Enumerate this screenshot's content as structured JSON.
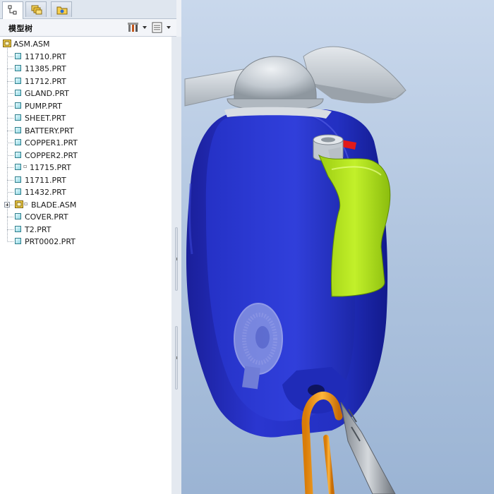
{
  "model_tree": {
    "title": "模型树",
    "root": "ASM.ASM",
    "items": [
      {
        "label": "11710.PRT",
        "kind": "part"
      },
      {
        "label": "11385.PRT",
        "kind": "part"
      },
      {
        "label": "11712.PRT",
        "kind": "part"
      },
      {
        "label": "GLAND.PRT",
        "kind": "part"
      },
      {
        "label": "PUMP.PRT",
        "kind": "part"
      },
      {
        "label": "SHEET.PRT",
        "kind": "part"
      },
      {
        "label": "BATTERY.PRT",
        "kind": "part"
      },
      {
        "label": "COPPER1.PRT",
        "kind": "part"
      },
      {
        "label": "COPPER2.PRT",
        "kind": "part"
      },
      {
        "label": "11715.PRT",
        "kind": "part"
      },
      {
        "label": "11711.PRT",
        "kind": "part"
      },
      {
        "label": "11432.PRT",
        "kind": "part"
      },
      {
        "label": "BLADE.ASM",
        "kind": "assembly"
      },
      {
        "label": "COVER.PRT",
        "kind": "part"
      },
      {
        "label": "T2.PRT",
        "kind": "part"
      },
      {
        "label": "PRT0002.PRT",
        "kind": "part"
      }
    ]
  },
  "tabs": [
    {
      "icon": "model-tree-icon",
      "active": true
    },
    {
      "icon": "layers-icon",
      "active": false
    },
    {
      "icon": "favorites-folder-icon",
      "active": false
    }
  ],
  "toolbar": {
    "settings_icon": "tree-settings-icon",
    "columns_icon": "tree-columns-icon"
  },
  "colors": {
    "body_blue": "#2433c8",
    "clip_green": "#b6e81f",
    "cap_gray": "#c4ccd3",
    "hook_orange": "#f39a16"
  }
}
